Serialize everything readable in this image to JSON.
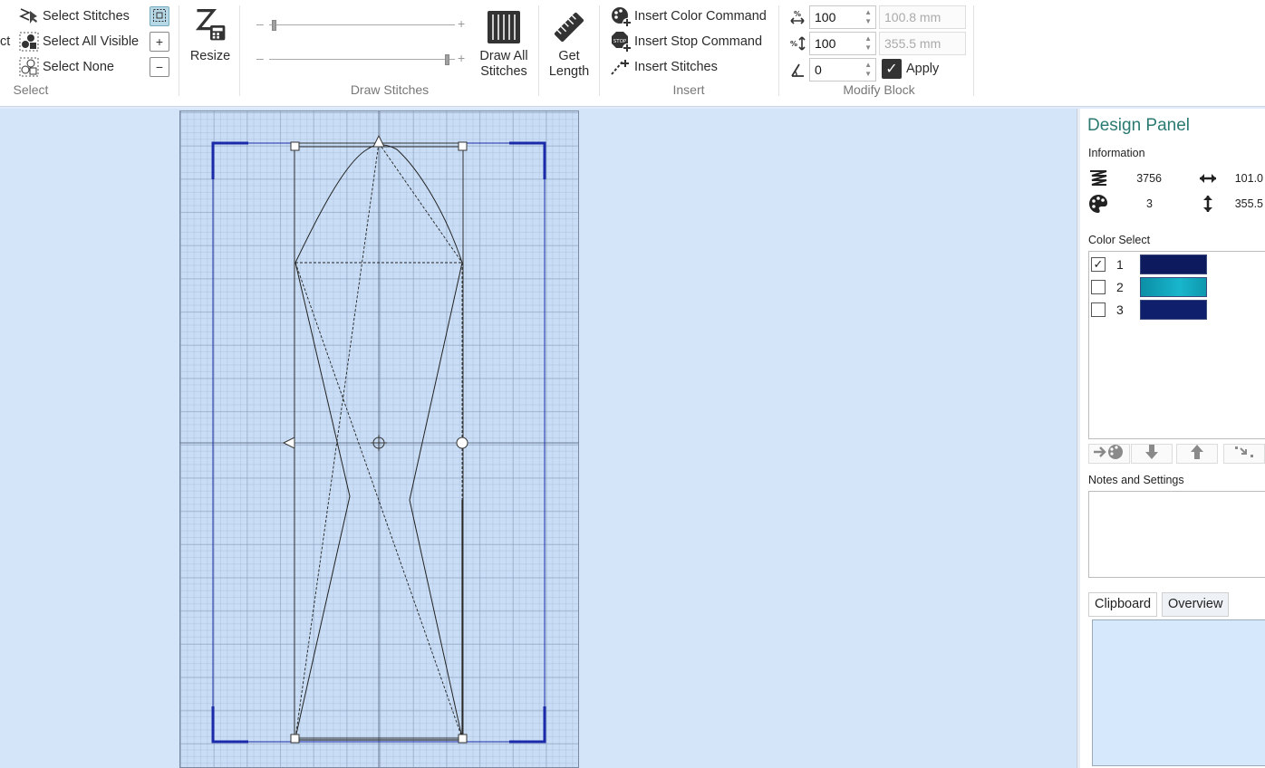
{
  "ribbon": {
    "select": {
      "cut_label": "ct",
      "select_stitches": "Select Stitches",
      "select_all_visible": "Select All Visible",
      "select_none": "Select None",
      "group_label": "Select"
    },
    "resize": {
      "label": "Resize"
    },
    "draw_stitches": {
      "draw_all_label_1": "Draw All",
      "draw_all_label_2": "Stitches",
      "group_label": "Draw Stitches",
      "slider_minus": "–",
      "slider_plus": "+"
    },
    "get_length": {
      "label_1": "Get",
      "label_2": "Length"
    },
    "insert": {
      "insert_color": "Insert Color Command",
      "insert_stop": "Insert Stop Command",
      "insert_stitches": "Insert Stitches",
      "group_label": "Insert"
    },
    "modify_block": {
      "width_pct": "100",
      "height_pct": "100",
      "angle": "0",
      "width_mm": "100.8 mm",
      "height_mm": "355.5 mm",
      "apply_label": "Apply",
      "group_label": "Modify Block"
    }
  },
  "panel": {
    "title": "Design Panel",
    "information_label": "Information",
    "stitch_count": "3756",
    "width_value": "101.0",
    "color_count": "3",
    "height_value": "355.5",
    "color_select_label": "Color Select",
    "colors": [
      {
        "num": "1",
        "checked": true,
        "hex": "#0d1a5e"
      },
      {
        "num": "2",
        "checked": false,
        "hex": "#0f9db5"
      },
      {
        "num": "3",
        "checked": false,
        "hex": "#0f1f6b"
      }
    ],
    "notes_label": "Notes and Settings",
    "tabs": {
      "clipboard": "Clipboard",
      "overview": "Overview"
    }
  },
  "colors": {
    "accent_teal": "#2c7a72",
    "canvas_bg": "#d4e5fa",
    "hoop_frame": "#1a2aa8"
  }
}
